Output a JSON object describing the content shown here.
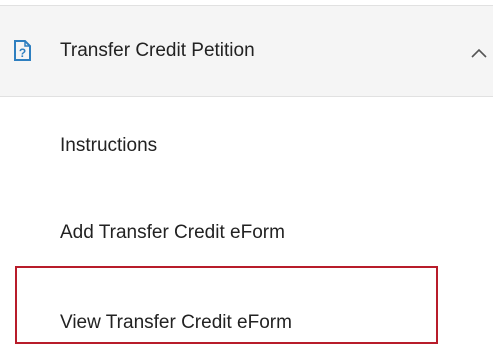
{
  "section": {
    "title": "Transfer Credit Petition",
    "icon": "document-question-icon",
    "toggle_icon": "chevron-up-icon",
    "expanded": true,
    "accent_color": "#2e7fc0"
  },
  "items": [
    {
      "label": "Instructions"
    },
    {
      "label": "Add Transfer Credit eForm"
    },
    {
      "label": "View Transfer Credit eForm"
    }
  ],
  "highlight": {
    "target": "View Transfer Credit eForm",
    "color": "#b81c2a"
  }
}
